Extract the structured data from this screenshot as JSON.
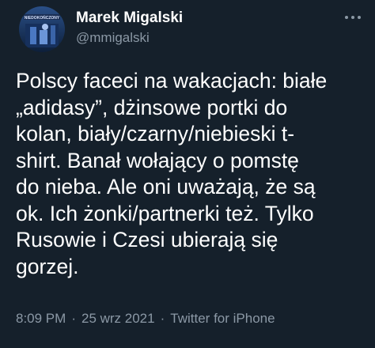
{
  "author": {
    "display_name": "Marek Migalski",
    "handle": "@mmigalski",
    "avatar_caption": "NIEDOKOŃCZONY"
  },
  "tweet": {
    "text": "Polscy faceci na wakacjach: białe\n„adidasy”, dżinsowe portki do\nkolan, biały/czarny/niebieski t-\nshirt. Banał wołający o pomstę\ndo nieba. Ale oni uważają, że są\nok. Ich żonki/partnerki też. Tylko\nRusowie i Czesi ubierają się\ngorzej."
  },
  "meta": {
    "time": "8:09 PM",
    "separator": "·",
    "date": "25 wrz 2021",
    "source": "Twitter for iPhone"
  },
  "colors": {
    "background": "#15202b",
    "primary_text": "#ffffff",
    "secondary_text": "#8b98a5"
  },
  "icons": {
    "more": "more-horizontal-icon"
  }
}
